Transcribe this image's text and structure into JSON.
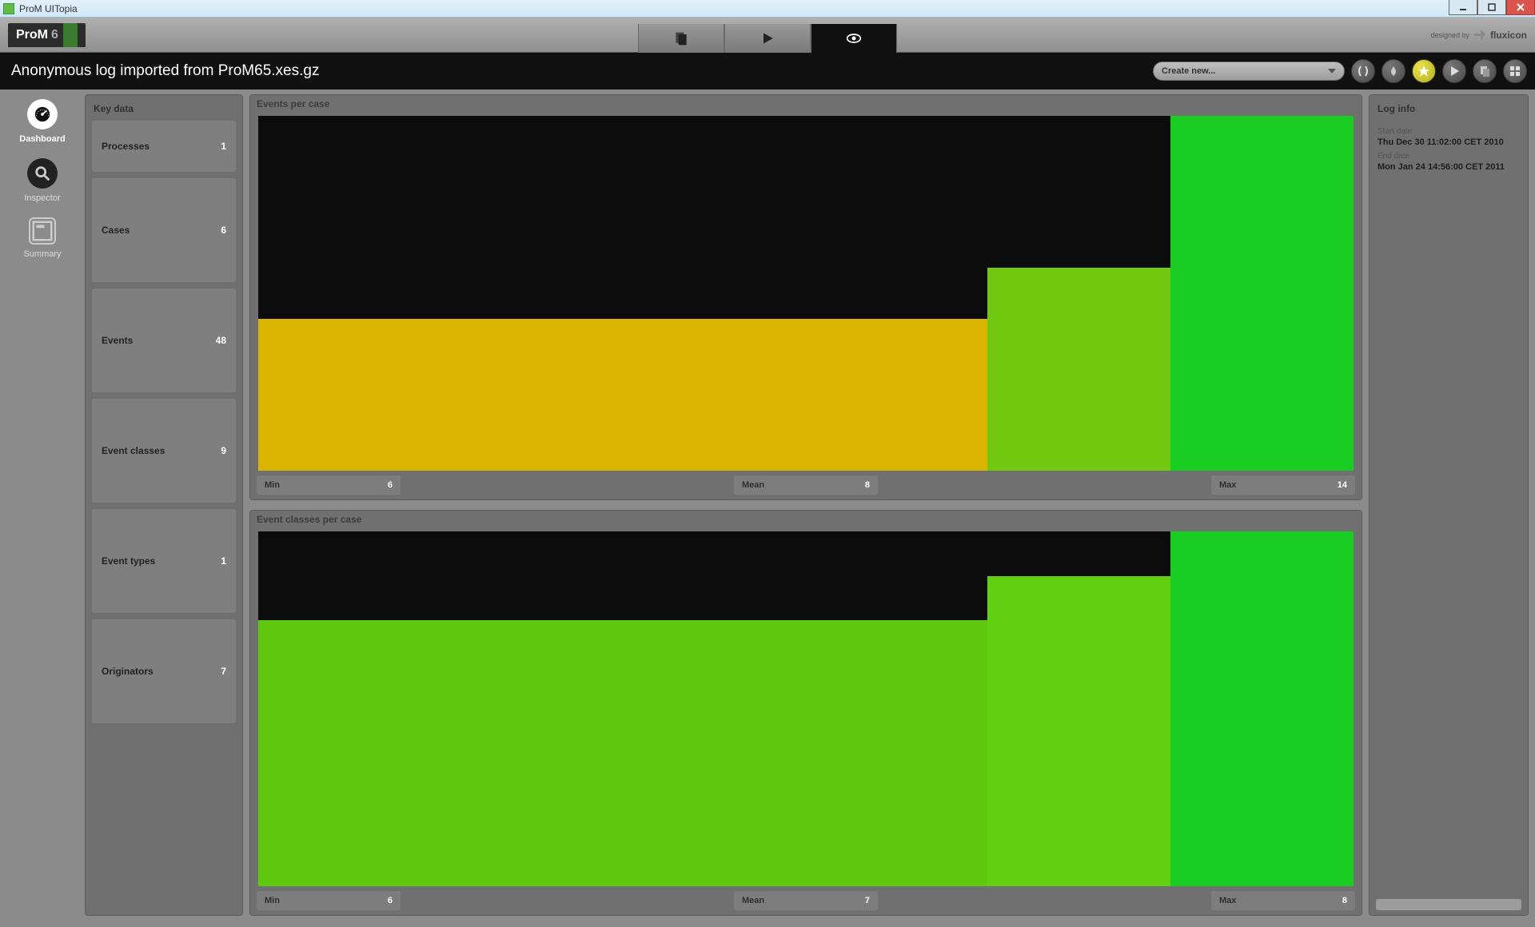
{
  "window": {
    "title": "ProM UITopia"
  },
  "app": {
    "logo_text": "ProM",
    "logo_ver": "6",
    "designed_by_label": "designed by",
    "designed_by_brand": "fluxicon"
  },
  "ribbon": {
    "title": "Anonymous log imported from ProM65.xes.gz",
    "create_label": "Create new..."
  },
  "nav": {
    "dashboard": "Dashboard",
    "inspector": "Inspector",
    "summary": "Summary"
  },
  "keydata": {
    "header": "Key data",
    "processes_label": "Processes",
    "processes_value": "1",
    "cases_label": "Cases",
    "cases_value": "6",
    "events_label": "Events",
    "events_value": "48",
    "eventclasses_label": "Event classes",
    "eventclasses_value": "9",
    "eventtypes_label": "Event types",
    "eventtypes_value": "1",
    "originators_label": "Originators",
    "originators_value": "7"
  },
  "charts": {
    "events_per_case": {
      "title": "Events per case",
      "min_label": "Min",
      "min_value": "6",
      "mean_label": "Mean",
      "mean_value": "8",
      "max_label": "Max",
      "max_value": "14"
    },
    "event_classes_per_case": {
      "title": "Event classes per case",
      "min_label": "Min",
      "min_value": "6",
      "mean_label": "Mean",
      "mean_value": "7",
      "max_label": "Max",
      "max_value": "8"
    }
  },
  "loginfo": {
    "header": "Log info",
    "start_label": "Start date",
    "start_value": "Thu Dec 30 11:02:00 CET 2010",
    "end_label": "End date",
    "end_value": "Mon Jan 24 14:56:00 CET 2011"
  },
  "chart_data": [
    {
      "type": "bar",
      "title": "Events per case",
      "categories": [
        "Min",
        "Mean",
        "Max"
      ],
      "values": [
        6,
        8,
        14
      ],
      "colors": [
        "#d9b400",
        "#72c80e",
        "#18cc21"
      ],
      "ylim": [
        0,
        14
      ],
      "widths_pct": [
        66.6,
        16.7,
        16.7
      ]
    },
    {
      "type": "bar",
      "title": "Event classes per case",
      "categories": [
        "Min",
        "Mean",
        "Max"
      ],
      "values": [
        6,
        7,
        8
      ],
      "colors": [
        "#5ec80e",
        "#60d010",
        "#18cc21"
      ],
      "ylim": [
        0,
        8
      ],
      "widths_pct": [
        66.6,
        16.7,
        16.7
      ]
    }
  ]
}
